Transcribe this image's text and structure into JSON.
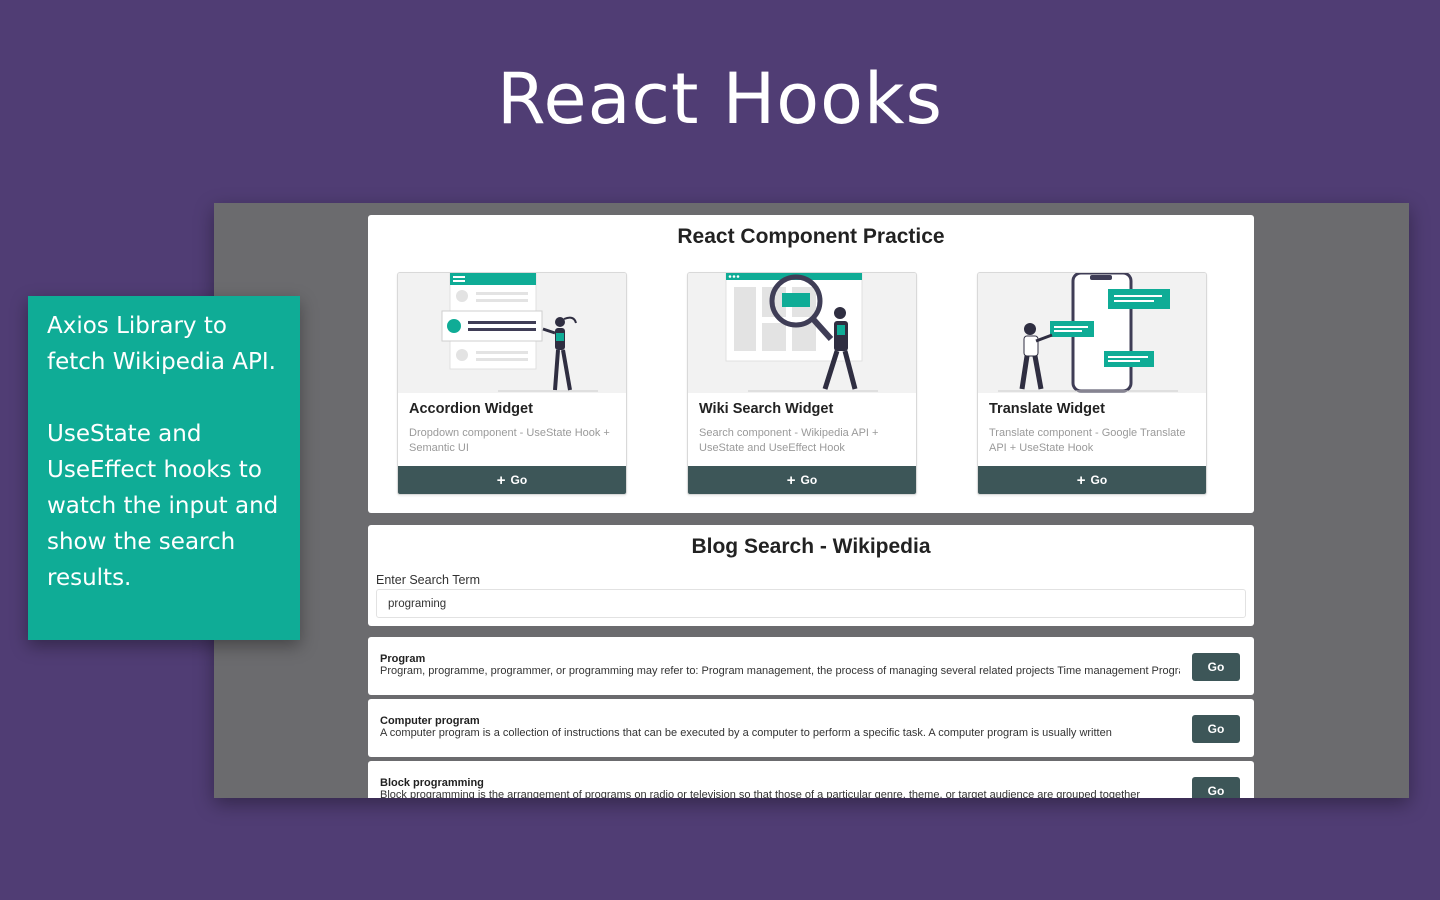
{
  "hero": {
    "title": "React Hooks"
  },
  "callout": {
    "paragraphs": [
      "Axios Library to fetch Wikipedia API.",
      "UseState and UseEffect hooks to watch the input and show the search results."
    ]
  },
  "practice": {
    "title": "React Component Practice",
    "cards": [
      {
        "title": "Accordion Widget",
        "description": "Dropdown component - UseState Hook + Semantic UI",
        "button": "Go"
      },
      {
        "title": "Wiki Search Widget",
        "description": "Search component - Wikipedia API + UseState and UseEffect Hook",
        "button": "Go"
      },
      {
        "title": "Translate Widget",
        "description": "Translate component - Google Translate API + UseState Hook",
        "button": "Go"
      }
    ]
  },
  "search": {
    "title": "Blog Search - Wikipedia",
    "label": "Enter Search Term",
    "value": "programing"
  },
  "results": [
    {
      "title": "Program",
      "snippet": "Program, programme, programmer, or programming may refer to: Program management, the process of managing several related projects Time management Program",
      "button": "Go"
    },
    {
      "title": "Computer program",
      "snippet": "A computer program is a collection of instructions that can be executed by a computer to perform a specific task. A computer program is usually written",
      "button": "Go"
    },
    {
      "title": "Block programming",
      "snippet": "Block programming is the arrangement of programs on radio or television so that those of a particular genre, theme, or target audience are grouped together",
      "button": "Go"
    }
  ],
  "colors": {
    "background": "#503d74",
    "accent": "#0fac96",
    "button": "#3d5658",
    "screen": "#6b6b6e"
  }
}
